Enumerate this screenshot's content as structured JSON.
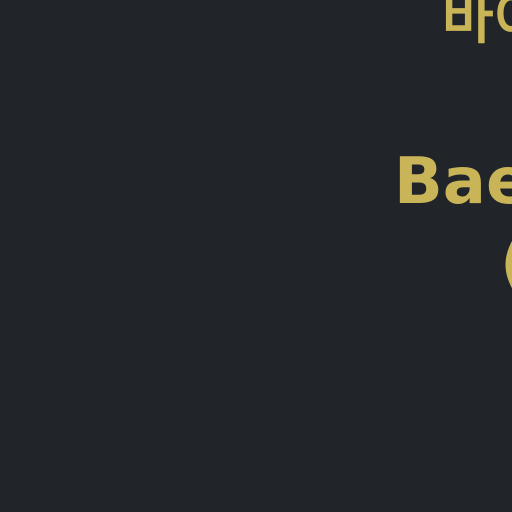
{
  "colors": {
    "background": "#212529",
    "text": "#c9b458"
  },
  "title_korean": "바이",
  "title_romanized": "Baek",
  "subtitle_fragment": "("
}
